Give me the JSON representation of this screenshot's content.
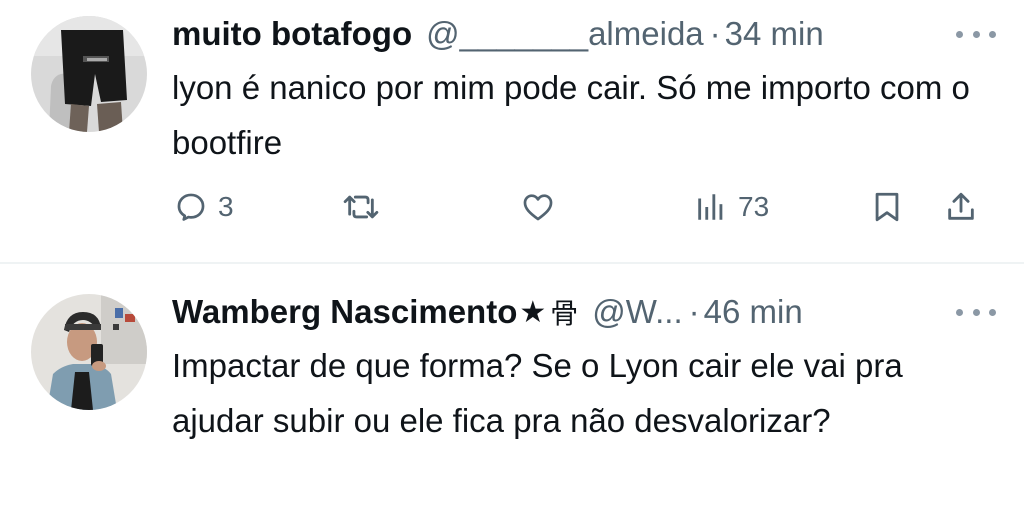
{
  "tweets": [
    {
      "display_name": "muito botafogo",
      "handle": "@_______almeida",
      "separator": "·",
      "time": "34 min",
      "text": "lyon é nanico por mim pode cair. Só me importo com o bootfire",
      "avatar_icon": "avatar-photo-dark-shorts",
      "actions": {
        "reply_count": "3",
        "retweet_count": "",
        "like_count": "",
        "views_count": "73"
      }
    },
    {
      "display_name": "Wamberg Nascimento",
      "star": "★",
      "badge_glyph": "⾻",
      "handle": "@W...",
      "separator": "·",
      "time": "46 min",
      "text": "Impactar de que forma? Se o Lyon cair ele vai pra ajudar subir ou ele fica pra não desvalorizar?",
      "avatar_icon": "avatar-photo-mirror-selfie"
    }
  ],
  "colors": {
    "text": "#0f1419",
    "secondary": "#536471",
    "divider": "#eff3f4"
  }
}
